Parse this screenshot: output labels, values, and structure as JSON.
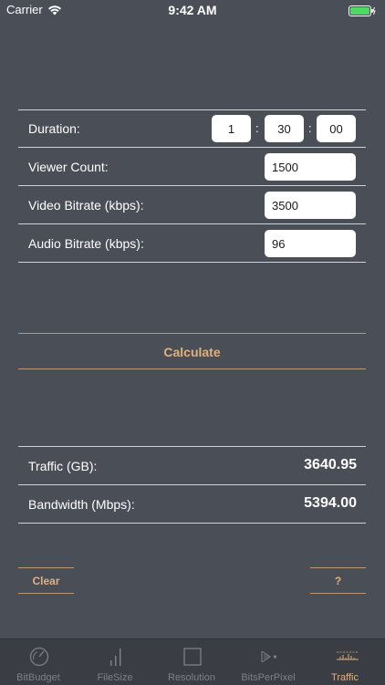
{
  "status_bar": {
    "carrier": "Carrier",
    "time": "9:42 AM"
  },
  "form": {
    "duration": {
      "label": "Duration:",
      "hours": "1",
      "minutes": "30",
      "seconds": "00",
      "separator": ":"
    },
    "viewer_count": {
      "label": "Viewer Count:",
      "value": "1500"
    },
    "video_bitrate": {
      "label": "Video Bitrate (kbps):",
      "value": "3500"
    },
    "audio_bitrate": {
      "label": "Audio Bitrate (kbps):",
      "value": "96"
    }
  },
  "calculate_label": "Calculate",
  "results": {
    "traffic": {
      "label": "Traffic (GB):",
      "value": "3640.95"
    },
    "bandwidth": {
      "label": "Bandwidth (Mbps):",
      "value": "5394.00"
    }
  },
  "buttons": {
    "clear": "Clear",
    "help": "?"
  },
  "tabs": [
    {
      "label": "BitBudget",
      "icon": "gauge-icon"
    },
    {
      "label": "FileSize",
      "icon": "bars-icon"
    },
    {
      "label": "Resolution",
      "icon": "square-icon"
    },
    {
      "label": "BitsPerPixel",
      "icon": "pixel-icon"
    },
    {
      "label": "Traffic",
      "icon": "traffic-icon",
      "active": true
    }
  ],
  "colors": {
    "background": "#4a4e56",
    "accent": "#e0b07e",
    "tabbar": "#3a3d43"
  }
}
